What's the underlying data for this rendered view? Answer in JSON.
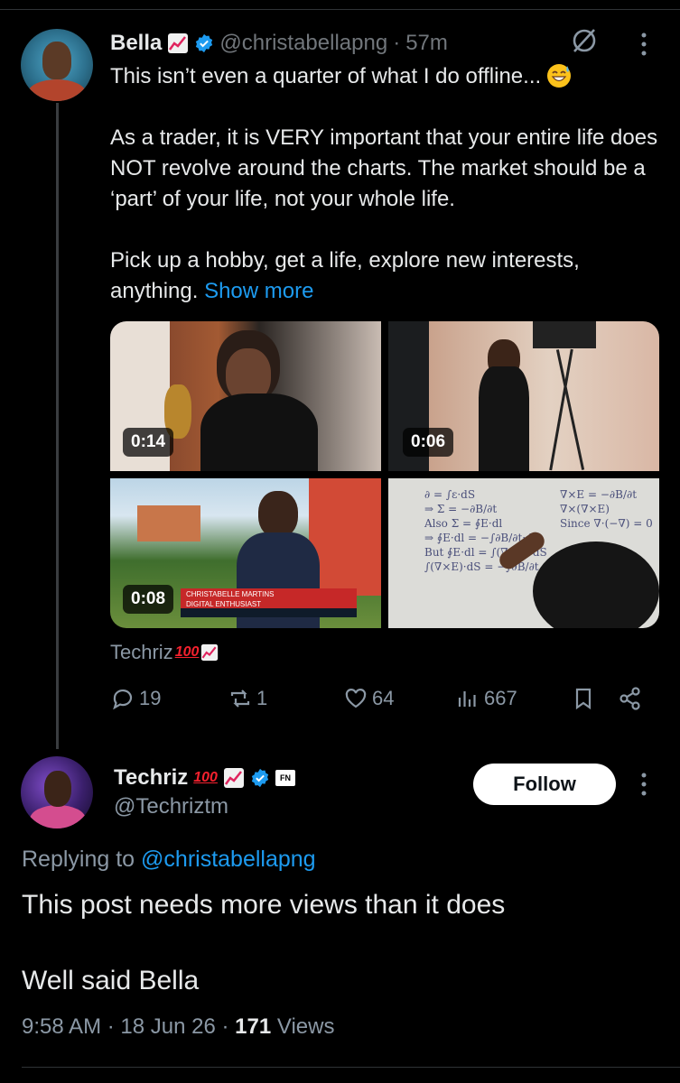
{
  "original_post": {
    "display_name": "Bella",
    "name_emoji": "chart-increasing-emoji",
    "handle": "@christabellapng",
    "separator": "·",
    "time": "57m",
    "line1": "This isn’t even a quarter of what I do offline...",
    "para2": "As a trader, it is VERY important that your entire life does NOT revolve around the charts. The market should be a ‘part’ of your life, not your whole life.",
    "para3": "Pick up a hobby, get a life, explore new interests, anything.",
    "show_more": "Show more",
    "media": [
      {
        "duration": "0:14"
      },
      {
        "duration": "0:06"
      },
      {
        "duration": "0:08",
        "lower_third_name": "CHRISTABELLE MARTINS",
        "lower_third_title": "DIGITAL ENTHUSIAST"
      },
      {
        "duration": ""
      }
    ],
    "credit": "Techriz",
    "credit_emoji": "100",
    "actions": {
      "replies": "19",
      "reposts": "1",
      "likes": "64",
      "views": "667"
    },
    "accent": "#1d9bf0"
  },
  "reply_post": {
    "display_name": "Techriz",
    "name_emoji": "100",
    "badge": "FN",
    "handle": "@Techriztm",
    "follow_label": "Follow",
    "replying_label": "Replying to",
    "replying_handle": "@christabellapng",
    "body": "This post needs more views than it does",
    "body2": "Well said Bella",
    "time": "9:58 AM",
    "date": "18 Jun 26",
    "sep": "·",
    "views_count": "171",
    "views_label": "Views"
  }
}
